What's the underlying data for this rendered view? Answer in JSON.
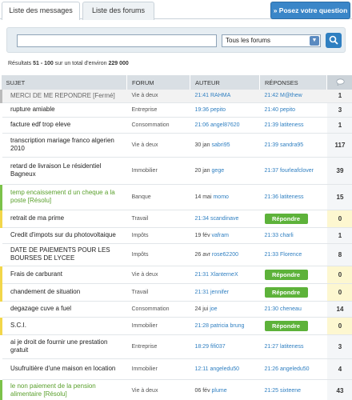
{
  "tabs": [
    {
      "label": "Liste des messages",
      "active": true
    },
    {
      "label": "Liste des forums",
      "active": false
    }
  ],
  "ask_button": "» Posez votre question",
  "search": {
    "value": "",
    "forum_selected": "Tous les forums"
  },
  "results": {
    "prefix": "Résultats",
    "range": "51 - 100",
    "middle": "sur un total d'environ",
    "total": "229 000"
  },
  "columns": {
    "subject": "SUJET",
    "forum": "FORUM",
    "author": "AUTEUR",
    "replies": "RÉPONSES"
  },
  "reply_label": "Répondre",
  "colors": {
    "accent": "#2f7fc1",
    "resolved": "#5aa02c",
    "reply_button": "#5db23a",
    "unanswered": "#f2d64a"
  },
  "rows": [
    {
      "status": "closed",
      "subject": "MERCI DE ME REPONDRE [Fermé]",
      "forum": "Vie à deux",
      "author_time": "21:41",
      "author": "RAHMA",
      "reply_time": "21:42",
      "reply_author": "M@thew",
      "count": "1"
    },
    {
      "status": "normal",
      "subject": "rupture amiable",
      "forum": "Entreprise",
      "author_time": "19:36",
      "author": "pepito",
      "reply_time": "21:40",
      "reply_author": "pepito",
      "count": "3"
    },
    {
      "status": "normal",
      "subject": "facture edf trop eleve",
      "forum": "Consommation",
      "author_time": "21:06",
      "author": "angel87620",
      "reply_time": "21:39",
      "reply_author": "latiteness",
      "count": "1"
    },
    {
      "status": "normal",
      "subject": "transcription mariage franco algerien 2010",
      "forum": "Vie à deux",
      "author_time": "30 jan",
      "author": "sabri95",
      "reply_time": "21:39",
      "reply_author": "sandra95",
      "count": "117"
    },
    {
      "status": "normal",
      "subject": "retard de livraison Le résidentiel Bagneux",
      "forum": "Immobilier",
      "author_time": "20 jan",
      "author": "gege",
      "reply_time": "21:37",
      "reply_author": "fourleafclover",
      "count": "39"
    },
    {
      "status": "resolved",
      "subject": "temp encaissement d un cheque a la poste [Résolu]",
      "forum": "Banque",
      "author_time": "14 mai",
      "author": "momo",
      "reply_time": "21:36",
      "reply_author": "latiteness",
      "count": "15"
    },
    {
      "status": "unanswered",
      "subject": "retrait de ma prime",
      "forum": "Travail",
      "author_time": "21:34",
      "author": "scandinave",
      "reply_time": "",
      "reply_author": "",
      "count": "0"
    },
    {
      "status": "normal",
      "subject": "Credit d'impots sur du photovoltaique",
      "forum": "Impôts",
      "author_time": "19 fév",
      "author": "vafram",
      "reply_time": "21:33",
      "reply_author": "charli",
      "count": "1"
    },
    {
      "status": "normal",
      "subject": "DATE DE PAIEMENTS POUR LES BOURSES DE LYCEE",
      "forum": "Impôts",
      "author_time": "26 avr",
      "author": "rose62200",
      "reply_time": "21:33",
      "reply_author": "Florence",
      "count": "8"
    },
    {
      "status": "unanswered",
      "subject": "Frais de carburant",
      "forum": "Vie à deux",
      "author_time": "21:31",
      "author": "XlanterneX",
      "reply_time": "",
      "reply_author": "",
      "count": "0"
    },
    {
      "status": "unanswered",
      "subject": "chandement de situation",
      "forum": "Travail",
      "author_time": "21:31",
      "author": "jennifer",
      "reply_time": "",
      "reply_author": "",
      "count": "0"
    },
    {
      "status": "normal",
      "subject": "degazage cuve a fuel",
      "forum": "Consommation",
      "author_time": "24 jui",
      "author": "joe",
      "reply_time": "21:30",
      "reply_author": "cheneau",
      "count": "14"
    },
    {
      "status": "unanswered",
      "subject": "S.C.I.",
      "forum": "Immobilier",
      "author_time": "21:28",
      "author": "patricia brung",
      "reply_time": "",
      "reply_author": "",
      "count": "0"
    },
    {
      "status": "normal",
      "subject": "ai je droit de fournir une prestation gratuit",
      "forum": "Entreprise",
      "author_time": "18:29",
      "author": "fifi037",
      "reply_time": "21:27",
      "reply_author": "latiteness",
      "count": "3"
    },
    {
      "status": "normal",
      "subject": "Usufruitière d'une maison en location",
      "forum": "Immobilier",
      "author_time": "12:11",
      "author": "angeledu50",
      "reply_time": "21:26",
      "reply_author": "angeledu50",
      "count": "4"
    },
    {
      "status": "resolved",
      "subject": "le non paiement de la pension alimentaire [Résolu]",
      "forum": "Vie à deux",
      "author_time": "06 fév",
      "author": "plume",
      "reply_time": "21:25",
      "reply_author": "sixteene",
      "count": "43"
    }
  ]
}
